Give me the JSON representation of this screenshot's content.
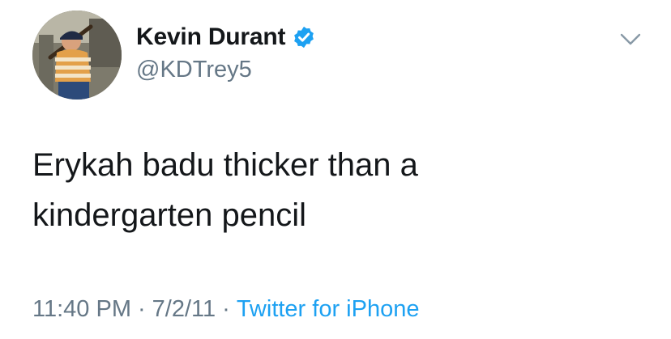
{
  "author": {
    "display_name": "Kevin Durant",
    "handle": "@KDTrey5",
    "verified": true
  },
  "tweet": {
    "text": "Erykah badu thicker than a\nkindergarten pencil",
    "time": "11:40 PM",
    "date": "7/2/11",
    "separator": "·",
    "source": "Twitter for iPhone"
  },
  "colors": {
    "text_primary": "#14171a",
    "text_secondary": "#657786",
    "link_blue": "#1da1f2"
  },
  "icons": {
    "verified": "verified-badge-icon",
    "menu": "chevron-down-icon"
  }
}
